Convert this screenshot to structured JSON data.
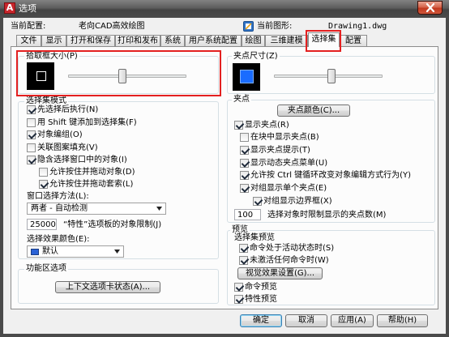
{
  "window": {
    "title": "选项",
    "app_logo_letter": "A"
  },
  "icons": {
    "app": "autocad-logo-icon",
    "close": "close-icon",
    "drawing": "drawing-file-icon",
    "dropdown": "chevron-down-icon"
  },
  "annotation": {
    "color": "#e32020"
  },
  "profile": {
    "current_profile_label": "当前配置:",
    "current_profile_value": "老向CAD高效绘图",
    "current_drawing_label": "当前图形:",
    "current_drawing_value": "Drawing1.dwg"
  },
  "tabs": [
    {
      "label": "文件",
      "active": false
    },
    {
      "label": "显示",
      "active": false
    },
    {
      "label": "打开和保存",
      "active": false
    },
    {
      "label": "打印和发布",
      "active": false
    },
    {
      "label": "系统",
      "active": false
    },
    {
      "label": "用户系统配置",
      "active": false
    },
    {
      "label": "绘图",
      "active": false
    },
    {
      "label": "三维建模",
      "active": false
    },
    {
      "label": "选择集",
      "active": true
    },
    {
      "label": "配置",
      "active": false
    }
  ],
  "pickbox": {
    "label": "拾取框大小(P)",
    "slider_level": 0.46,
    "preview_color": "#000000"
  },
  "selection_modes": {
    "title": "选择集模式",
    "options": [
      {
        "label": "先选择后执行(N)",
        "checked": true
      },
      {
        "label": "用 Shift 键添加到选择集(F)",
        "checked": false
      },
      {
        "label": "对象编组(O)",
        "checked": true
      },
      {
        "label": "关联图案填充(V)",
        "checked": false
      },
      {
        "label": "隐含选择窗口中的对象(I)",
        "checked": true
      },
      {
        "label": "允许按住并拖动对象(D)",
        "checked": false
      },
      {
        "label": "允许按住并拖动套索(L)",
        "checked": true
      }
    ],
    "window_method_label": "窗口选择方法(L):",
    "window_method_value": "两者 - 自动检测",
    "object_limit_value": "25000",
    "object_limit_label": "“特性”选项板的对象限制(J)",
    "effect_color_label": "选择效果颜色(E):",
    "effect_color_value": "默认",
    "effect_color_swatch": "#2a62d6"
  },
  "ribbon": {
    "title": "功能区选项",
    "context_tab_button": "上下文选项卡状态(A)..."
  },
  "grip_size": {
    "label": "夹点尺寸(Z)",
    "slider_level": 0.53,
    "grip_color": "#1a6cff"
  },
  "grips": {
    "title": "夹点",
    "color_button": "夹点颜色(C)...",
    "options": [
      {
        "label": "显示夹点(R)",
        "checked": true
      },
      {
        "label": "在块中显示夹点(B)",
        "checked": false
      },
      {
        "label": "显示夹点提示(T)",
        "checked": true
      },
      {
        "label": "显示动态夹点菜单(U)",
        "checked": true
      },
      {
        "label": "允许按 Ctrl 键循环改变对象编辑方式行为(Y)",
        "checked": true
      },
      {
        "label": "对组显示单个夹点(E)",
        "checked": true
      },
      {
        "label": "对组显示边界框(X)",
        "checked": true
      }
    ],
    "limit_value": "100",
    "limit_label": "选择对象时限制显示的夹点数(M)"
  },
  "preview": {
    "title": "预览",
    "selection_preview_label": "选择集预览",
    "selection_preview_options": [
      {
        "label": "命令处于活动状态时(S)",
        "checked": true
      },
      {
        "label": "未激活任何命令时(W)",
        "checked": true
      }
    ],
    "visual_effects_button": "视觉效果设置(G)...",
    "command_preview": {
      "label": "命令预览",
      "checked": true
    },
    "property_preview": {
      "label": "特性预览",
      "checked": true
    }
  },
  "footer": {
    "ok": "确定",
    "cancel": "取消",
    "apply": "应用(A)",
    "help": "帮助(H)"
  }
}
